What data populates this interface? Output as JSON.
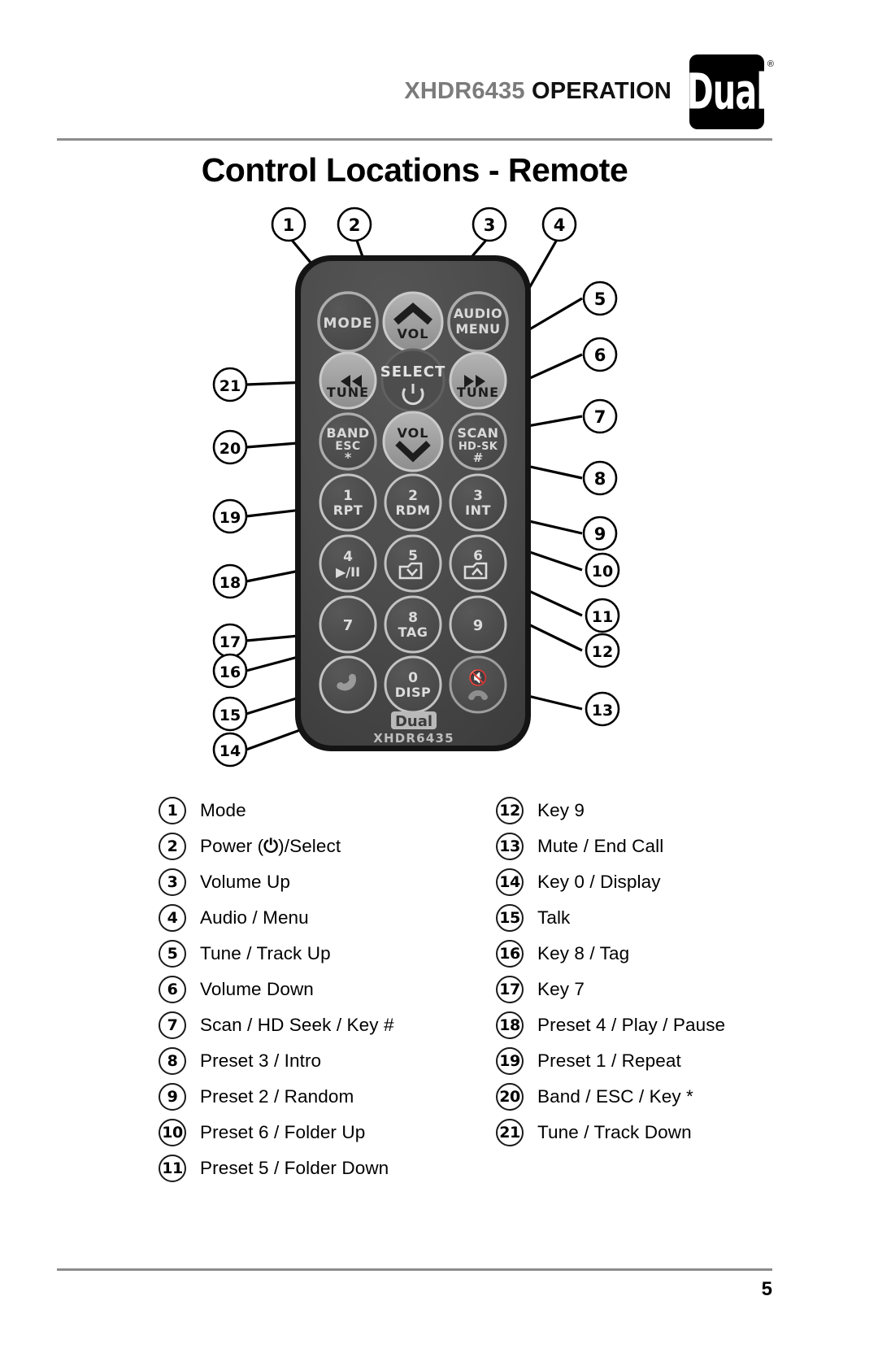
{
  "header": {
    "model": "XHDR6435",
    "section": "OPERATION",
    "logo_text": "Dual",
    "logo_registered": "®"
  },
  "page_title": "Control Locations - Remote",
  "page_number": "5",
  "remote": {
    "brand_label": "Dual",
    "model_label": "XHDR6435",
    "buttons": [
      {
        "id": "mode",
        "lines": [
          "MODE"
        ]
      },
      {
        "id": "vol-up",
        "lines": [
          "VOL"
        ]
      },
      {
        "id": "audio-menu",
        "lines": [
          "AUDIO",
          "MENU"
        ]
      },
      {
        "id": "tune-down",
        "lines": [
          "TUNE"
        ]
      },
      {
        "id": "select",
        "lines": [
          "SELECT"
        ]
      },
      {
        "id": "tune-up",
        "lines": [
          "TUNE"
        ]
      },
      {
        "id": "band-esc",
        "lines": [
          "BAND",
          "ESC",
          "*"
        ]
      },
      {
        "id": "vol-down",
        "lines": [
          "VOL"
        ]
      },
      {
        "id": "scan-hd-seek",
        "lines": [
          "SCAN",
          "HD-SK",
          "#"
        ]
      },
      {
        "id": "key-1",
        "lines": [
          "1",
          "RPT"
        ]
      },
      {
        "id": "key-2",
        "lines": [
          "2",
          "RDM"
        ]
      },
      {
        "id": "key-3",
        "lines": [
          "3",
          "INT"
        ]
      },
      {
        "id": "key-4",
        "lines": [
          "4",
          "▶/II"
        ]
      },
      {
        "id": "key-5",
        "lines": [
          "5"
        ]
      },
      {
        "id": "key-6",
        "lines": [
          "6"
        ]
      },
      {
        "id": "key-7",
        "lines": [
          "7"
        ]
      },
      {
        "id": "key-8",
        "lines": [
          "8",
          "TAG"
        ]
      },
      {
        "id": "key-9",
        "lines": [
          "9"
        ]
      },
      {
        "id": "talk",
        "lines": []
      },
      {
        "id": "key-0",
        "lines": [
          "0",
          "DISP"
        ]
      },
      {
        "id": "mute-end-call",
        "lines": []
      }
    ],
    "callouts": [
      "1",
      "2",
      "3",
      "4",
      "5",
      "6",
      "7",
      "8",
      "9",
      "10",
      "11",
      "12",
      "13",
      "14",
      "15",
      "16",
      "17",
      "18",
      "19",
      "20",
      "21"
    ]
  },
  "legend": {
    "left": [
      {
        "num": "1",
        "label": "Mode"
      },
      {
        "num": "2",
        "label": "Power (⏻)/Select",
        "pre": "Power (",
        "glyph": "⏻",
        "post": ")/Select"
      },
      {
        "num": "3",
        "label": "Volume Up"
      },
      {
        "num": "4",
        "label": "Audio / Menu"
      },
      {
        "num": "5",
        "label": "Tune / Track Up"
      },
      {
        "num": "6",
        "label": "Volume Down"
      },
      {
        "num": "7",
        "label": "Scan / HD Seek / Key #"
      },
      {
        "num": "8",
        "label": "Preset 3 / Intro"
      },
      {
        "num": "9",
        "label": "Preset 2 / Random"
      },
      {
        "num": "10",
        "label": "Preset 6 / Folder Up"
      },
      {
        "num": "11",
        "label": "Preset 5 / Folder Down"
      }
    ],
    "right": [
      {
        "num": "12",
        "label": "Key 9"
      },
      {
        "num": "13",
        "label": "Mute / End Call"
      },
      {
        "num": "14",
        "label": "Key 0 / Display"
      },
      {
        "num": "15",
        "label": "Talk"
      },
      {
        "num": "16",
        "label": "Key 8 / Tag"
      },
      {
        "num": "17",
        "label": "Key 7"
      },
      {
        "num": "18",
        "label": "Preset 4 / Play / Pause"
      },
      {
        "num": "19",
        "label": "Preset 1 / Repeat"
      },
      {
        "num": "20",
        "label": "Band / ESC / Key *"
      },
      {
        "num": "21",
        "label": "Tune / Track Down"
      }
    ]
  },
  "colors": {
    "model_gray": "#7b7b7b",
    "rule_gray": "#8c8c8c",
    "remote_body": "#4a4a4a",
    "remote_edge": "#171717",
    "button_light": "#9a9a9a",
    "text_black": "#000000"
  }
}
